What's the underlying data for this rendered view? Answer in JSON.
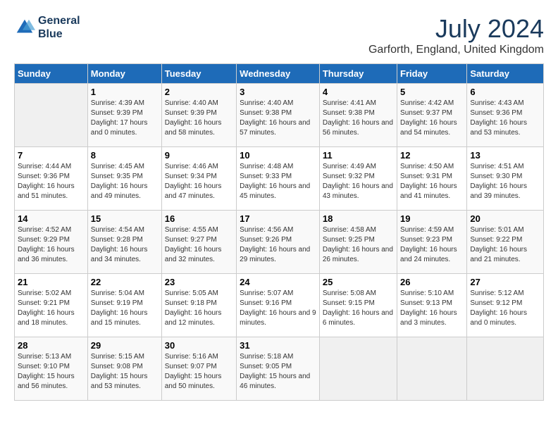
{
  "header": {
    "logo_line1": "General",
    "logo_line2": "Blue",
    "month": "July 2024",
    "location": "Garforth, England, United Kingdom"
  },
  "weekdays": [
    "Sunday",
    "Monday",
    "Tuesday",
    "Wednesday",
    "Thursday",
    "Friday",
    "Saturday"
  ],
  "weeks": [
    [
      {
        "day": "",
        "empty": true
      },
      {
        "day": "1",
        "sunrise": "4:39 AM",
        "sunset": "9:39 PM",
        "daylight": "17 hours and 0 minutes."
      },
      {
        "day": "2",
        "sunrise": "4:40 AM",
        "sunset": "9:39 PM",
        "daylight": "16 hours and 58 minutes."
      },
      {
        "day": "3",
        "sunrise": "4:40 AM",
        "sunset": "9:38 PM",
        "daylight": "16 hours and 57 minutes."
      },
      {
        "day": "4",
        "sunrise": "4:41 AM",
        "sunset": "9:38 PM",
        "daylight": "16 hours and 56 minutes."
      },
      {
        "day": "5",
        "sunrise": "4:42 AM",
        "sunset": "9:37 PM",
        "daylight": "16 hours and 54 minutes."
      },
      {
        "day": "6",
        "sunrise": "4:43 AM",
        "sunset": "9:36 PM",
        "daylight": "16 hours and 53 minutes."
      }
    ],
    [
      {
        "day": "7",
        "sunrise": "4:44 AM",
        "sunset": "9:36 PM",
        "daylight": "16 hours and 51 minutes."
      },
      {
        "day": "8",
        "sunrise": "4:45 AM",
        "sunset": "9:35 PM",
        "daylight": "16 hours and 49 minutes."
      },
      {
        "day": "9",
        "sunrise": "4:46 AM",
        "sunset": "9:34 PM",
        "daylight": "16 hours and 47 minutes."
      },
      {
        "day": "10",
        "sunrise": "4:48 AM",
        "sunset": "9:33 PM",
        "daylight": "16 hours and 45 minutes."
      },
      {
        "day": "11",
        "sunrise": "4:49 AM",
        "sunset": "9:32 PM",
        "daylight": "16 hours and 43 minutes."
      },
      {
        "day": "12",
        "sunrise": "4:50 AM",
        "sunset": "9:31 PM",
        "daylight": "16 hours and 41 minutes."
      },
      {
        "day": "13",
        "sunrise": "4:51 AM",
        "sunset": "9:30 PM",
        "daylight": "16 hours and 39 minutes."
      }
    ],
    [
      {
        "day": "14",
        "sunrise": "4:52 AM",
        "sunset": "9:29 PM",
        "daylight": "16 hours and 36 minutes."
      },
      {
        "day": "15",
        "sunrise": "4:54 AM",
        "sunset": "9:28 PM",
        "daylight": "16 hours and 34 minutes."
      },
      {
        "day": "16",
        "sunrise": "4:55 AM",
        "sunset": "9:27 PM",
        "daylight": "16 hours and 32 minutes."
      },
      {
        "day": "17",
        "sunrise": "4:56 AM",
        "sunset": "9:26 PM",
        "daylight": "16 hours and 29 minutes."
      },
      {
        "day": "18",
        "sunrise": "4:58 AM",
        "sunset": "9:25 PM",
        "daylight": "16 hours and 26 minutes."
      },
      {
        "day": "19",
        "sunrise": "4:59 AM",
        "sunset": "9:23 PM",
        "daylight": "16 hours and 24 minutes."
      },
      {
        "day": "20",
        "sunrise": "5:01 AM",
        "sunset": "9:22 PM",
        "daylight": "16 hours and 21 minutes."
      }
    ],
    [
      {
        "day": "21",
        "sunrise": "5:02 AM",
        "sunset": "9:21 PM",
        "daylight": "16 hours and 18 minutes."
      },
      {
        "day": "22",
        "sunrise": "5:04 AM",
        "sunset": "9:19 PM",
        "daylight": "16 hours and 15 minutes."
      },
      {
        "day": "23",
        "sunrise": "5:05 AM",
        "sunset": "9:18 PM",
        "daylight": "16 hours and 12 minutes."
      },
      {
        "day": "24",
        "sunrise": "5:07 AM",
        "sunset": "9:16 PM",
        "daylight": "16 hours and 9 minutes."
      },
      {
        "day": "25",
        "sunrise": "5:08 AM",
        "sunset": "9:15 PM",
        "daylight": "16 hours and 6 minutes."
      },
      {
        "day": "26",
        "sunrise": "5:10 AM",
        "sunset": "9:13 PM",
        "daylight": "16 hours and 3 minutes."
      },
      {
        "day": "27",
        "sunrise": "5:12 AM",
        "sunset": "9:12 PM",
        "daylight": "16 hours and 0 minutes."
      }
    ],
    [
      {
        "day": "28",
        "sunrise": "5:13 AM",
        "sunset": "9:10 PM",
        "daylight": "15 hours and 56 minutes."
      },
      {
        "day": "29",
        "sunrise": "5:15 AM",
        "sunset": "9:08 PM",
        "daylight": "15 hours and 53 minutes."
      },
      {
        "day": "30",
        "sunrise": "5:16 AM",
        "sunset": "9:07 PM",
        "daylight": "15 hours and 50 minutes."
      },
      {
        "day": "31",
        "sunrise": "5:18 AM",
        "sunset": "9:05 PM",
        "daylight": "15 hours and 46 minutes."
      },
      {
        "day": "",
        "empty": true
      },
      {
        "day": "",
        "empty": true
      },
      {
        "day": "",
        "empty": true
      }
    ]
  ]
}
